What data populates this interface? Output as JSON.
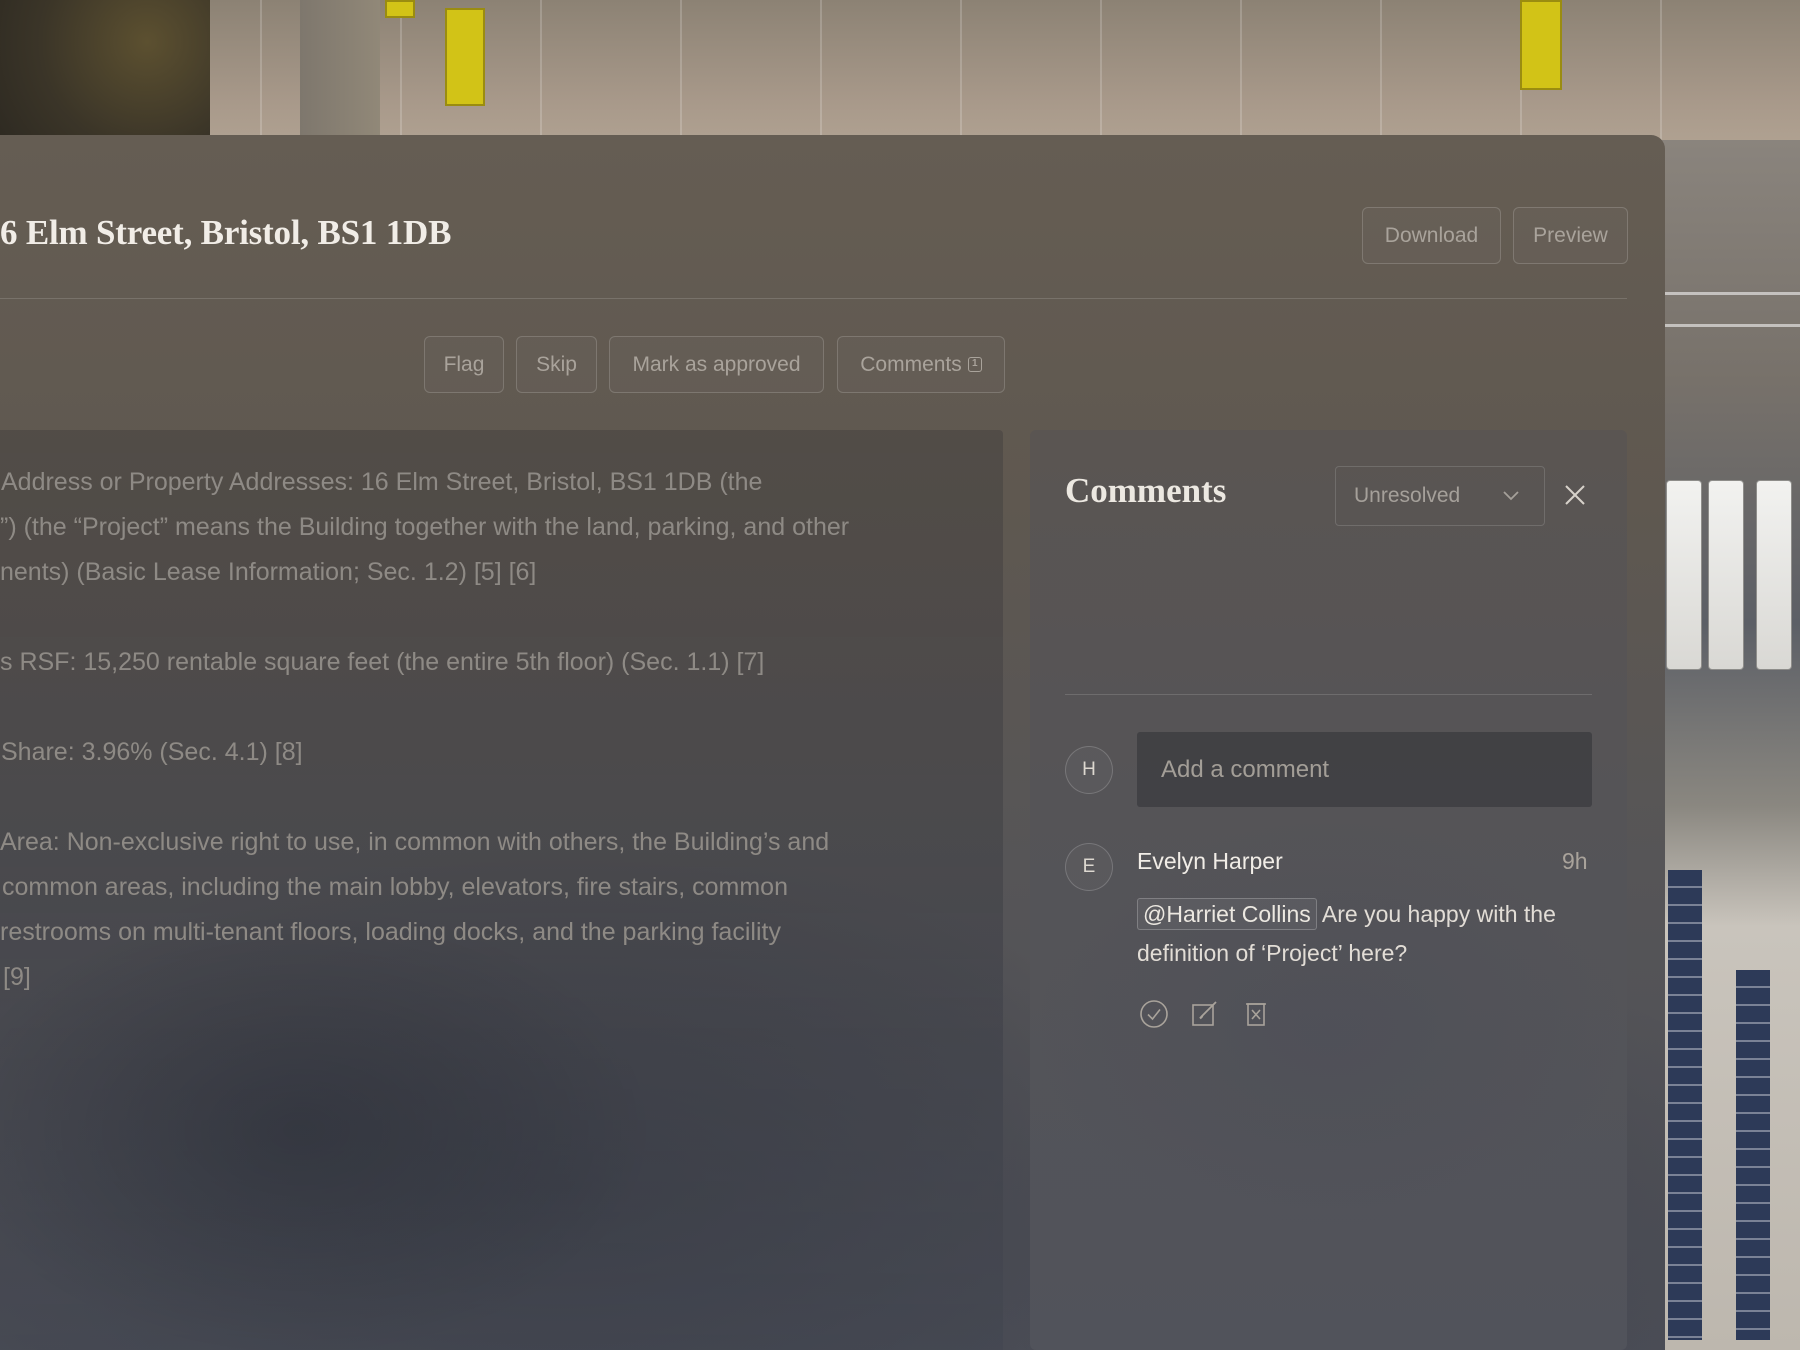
{
  "header": {
    "title": "6 Elm Street, Bristol, BS1 1DB",
    "download_label": "Download",
    "preview_label": "Preview"
  },
  "toolbar": {
    "flag_label": "Flag",
    "skip_label": "Skip",
    "approve_label": "Mark as approved",
    "comments_label": "Comments",
    "comments_count": "1"
  },
  "document": {
    "lines": [
      "Address or Property Addresses: 16 Elm Street, Bristol, BS1 1DB (the",
      "”) (the “Project” means the Building together with the land, parking, and other",
      "nents) (Basic Lease Information; Sec. 1.2) [5] [6]",
      "s RSF: 15,250 rentable square feet (the entire 5th floor) (Sec. 1.1) [7]",
      "Share: 3.96% (Sec. 4.1) [8]",
      " Area: Non-exclusive right to use, in common with others, the Building’s and",
      "common areas, including the main lobby, elevators, fire stairs, common",
      " restrooms on multi-tenant floors, loading docks, and the parking facility",
      "[9]"
    ]
  },
  "comments_panel": {
    "title": "Comments",
    "filter_value": "Unresolved",
    "current_user_initial": "H",
    "input_placeholder": "Add a comment",
    "items": [
      {
        "initial": "E",
        "author": "Evelyn Harper",
        "time": "9h",
        "mention": "@Harriet Collins",
        "text_after_mention": " Are you happy with the definition of ‘Project’ here?"
      }
    ]
  },
  "icons": {
    "resolve": "check-circle-icon",
    "edit": "edit-icon",
    "delete": "delete-icon",
    "close": "close-icon",
    "dropdown": "chevron-down-icon",
    "info": "info-icon"
  }
}
